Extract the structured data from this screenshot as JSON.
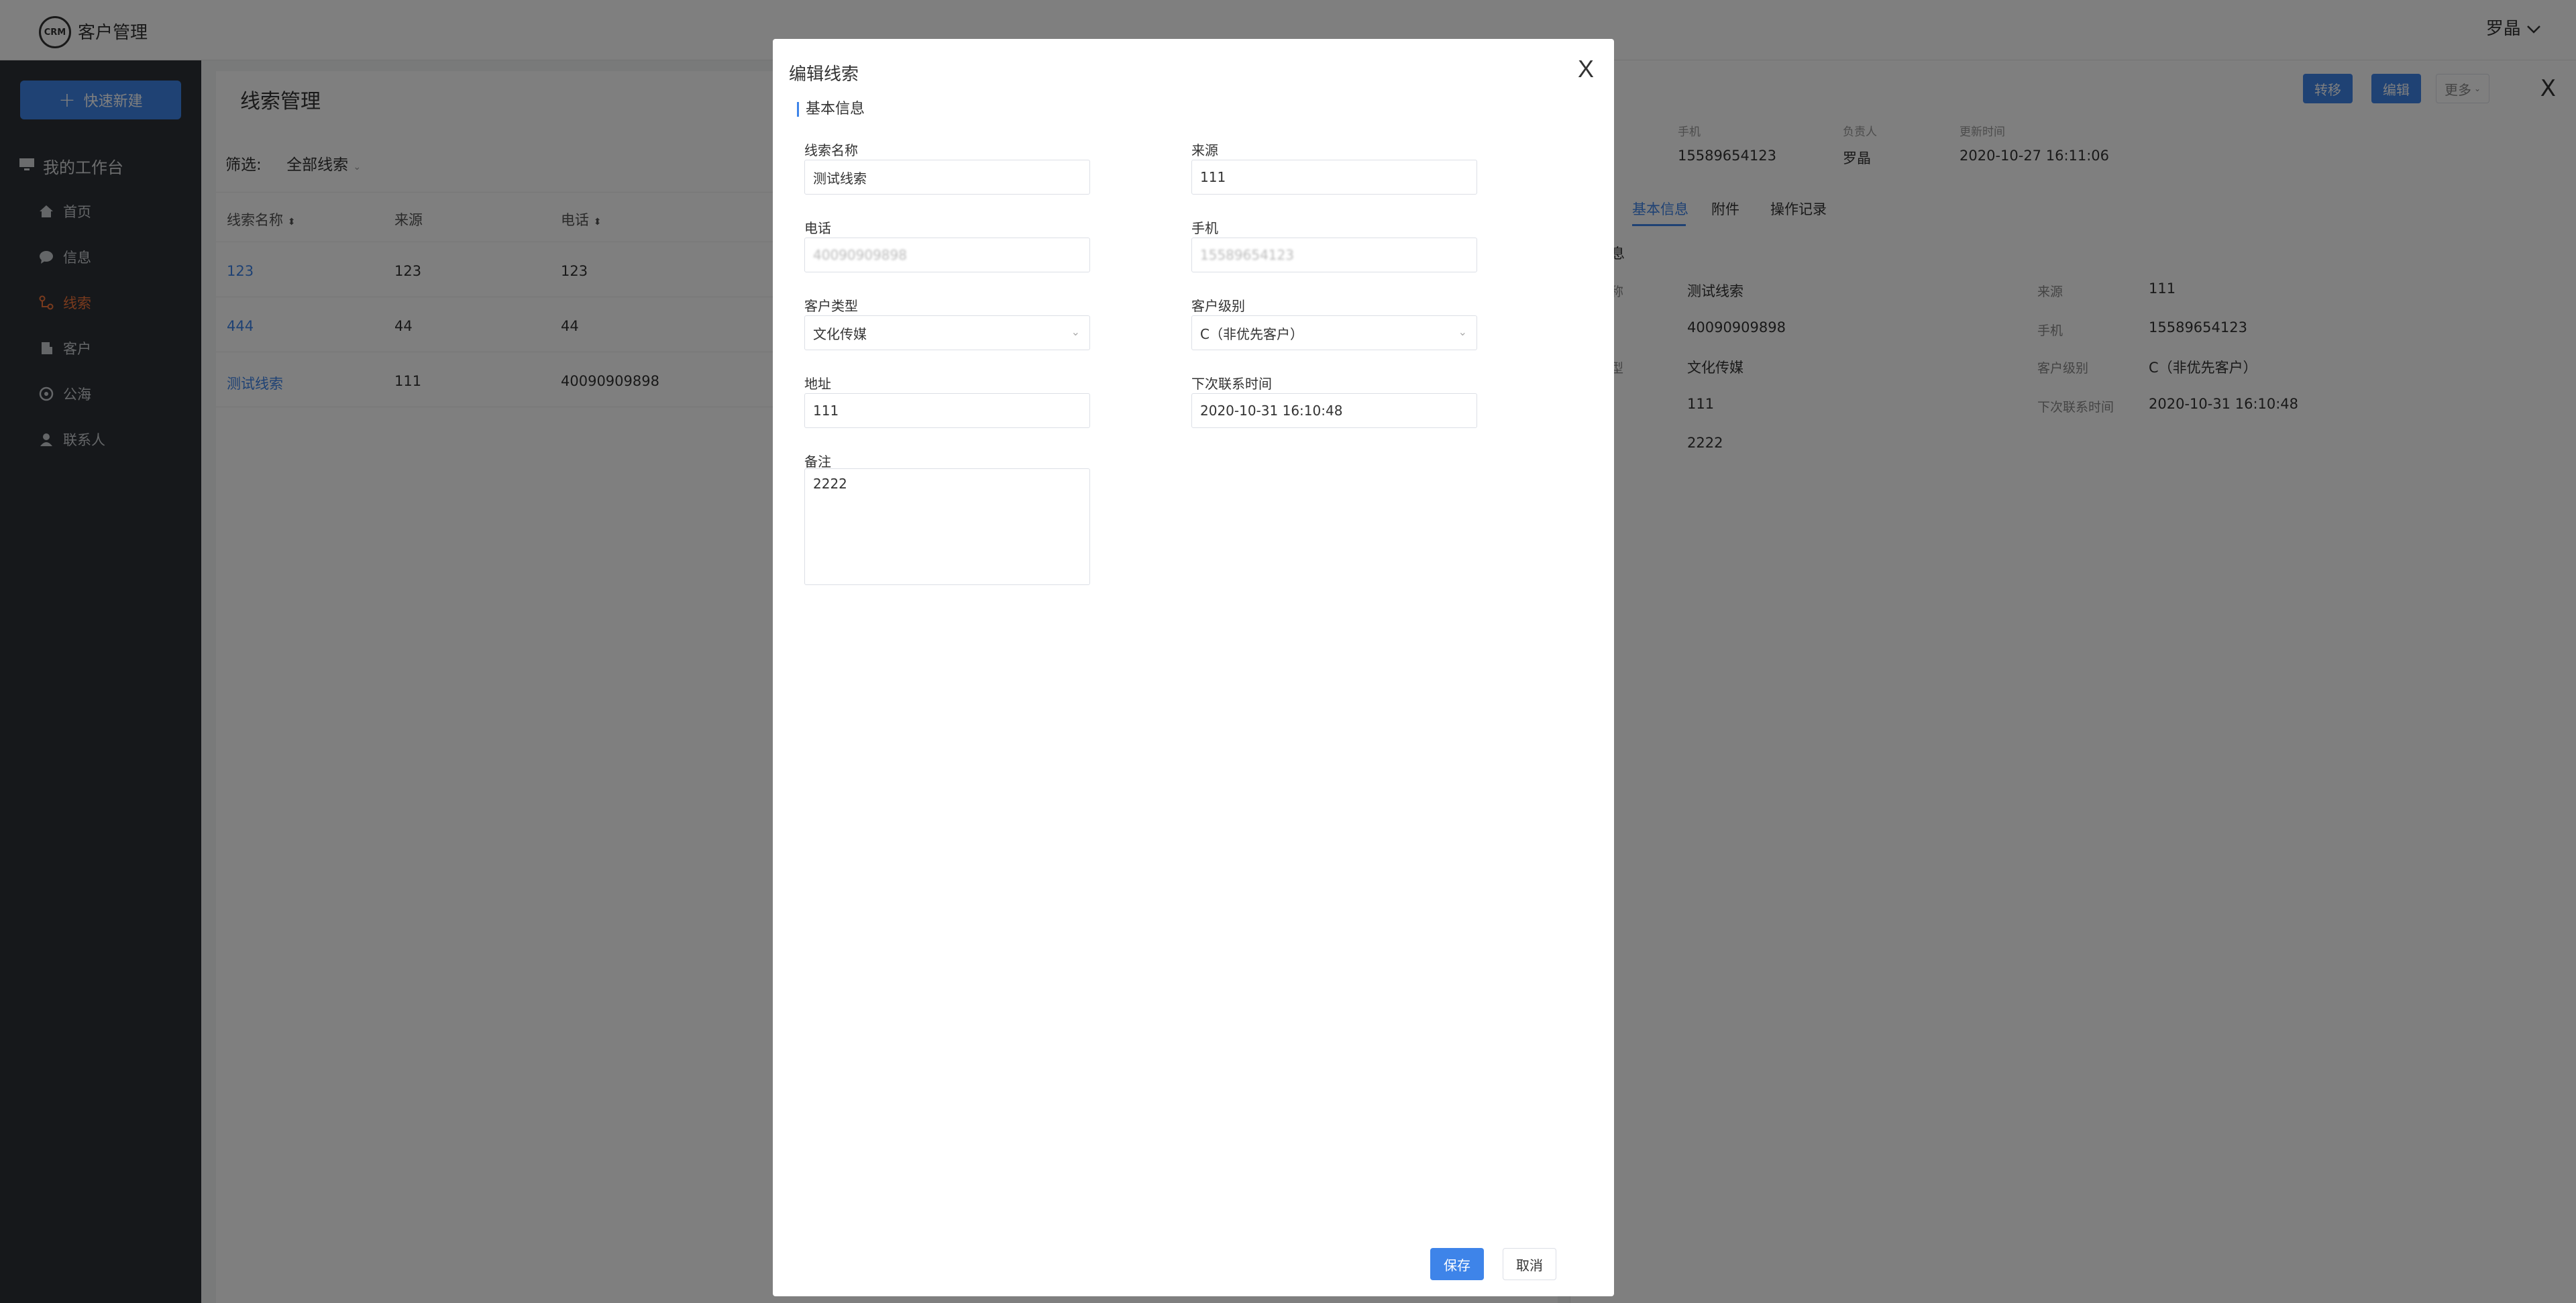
{
  "topbar": {
    "logo_text": "CRM",
    "app_title": "客户管理",
    "user_name": "罗晶"
  },
  "sidebar": {
    "quick_new_label": "快速新建",
    "workbench_label": "我的工作台",
    "items": [
      {
        "label": "首页",
        "icon": "home-icon"
      },
      {
        "label": "信息",
        "icon": "message-icon"
      },
      {
        "label": "线索",
        "icon": "leads-icon",
        "active": true
      },
      {
        "label": "客户",
        "icon": "customer-icon"
      },
      {
        "label": "公海",
        "icon": "pool-icon"
      },
      {
        "label": "联系人",
        "icon": "contact-icon"
      }
    ]
  },
  "list": {
    "title": "线索管理",
    "filter_label": "筛选:",
    "filter_value": "全部线索",
    "columns": [
      "线索名称",
      "来源",
      "电话"
    ],
    "rows": [
      [
        "123",
        "123",
        "123"
      ],
      [
        "444",
        "44",
        "44"
      ],
      [
        "测试线索",
        "111",
        "40090909898"
      ]
    ]
  },
  "detail": {
    "buttons": {
      "transfer": "转移",
      "edit": "编辑",
      "more": "更多"
    },
    "close": "X",
    "meta": [
      {
        "label": "手机",
        "value": "15589654123"
      },
      {
        "label": "负责人",
        "value": "罗晶"
      },
      {
        "label": "更新时间",
        "value": "2020-10-27 16:11:06"
      }
    ],
    "tabs": [
      "基本信息",
      "附件",
      "操作记录"
    ],
    "section_fragment": "息",
    "fields": [
      {
        "label": "称",
        "value": "测试线索",
        "label2": "来源",
        "value2": "111"
      },
      {
        "label": "",
        "value": "40090909898",
        "label2": "手机",
        "value2": "15589654123"
      },
      {
        "label": "型",
        "value": "文化传媒",
        "label2": "客户级别",
        "value2": "C（非优先客户）"
      },
      {
        "label": "",
        "value": "111",
        "label2": "下次联系时间",
        "value2": "2020-10-31 16:10:48"
      },
      {
        "label": "",
        "value": "2222",
        "label2": "",
        "value2": ""
      }
    ]
  },
  "modal": {
    "title": "编辑线索",
    "close": "X",
    "section": "基本信息",
    "fields": {
      "name": {
        "label": "线索名称",
        "value": "测试线索"
      },
      "source": {
        "label": "来源",
        "value": "111"
      },
      "phone": {
        "label": "电话",
        "value": "40090909898"
      },
      "mobile": {
        "label": "手机",
        "value": "15589654123"
      },
      "customer_type": {
        "label": "客户类型",
        "value": "文化传媒"
      },
      "customer_level": {
        "label": "客户级别",
        "value": "C（非优先客户）"
      },
      "address": {
        "label": "地址",
        "value": "111"
      },
      "next_contact": {
        "label": "下次联系时间",
        "value": "2020-10-31 16:10:48"
      },
      "remark": {
        "label": "备注",
        "value": "2222"
      }
    },
    "save_label": "保存",
    "cancel_label": "取消"
  }
}
